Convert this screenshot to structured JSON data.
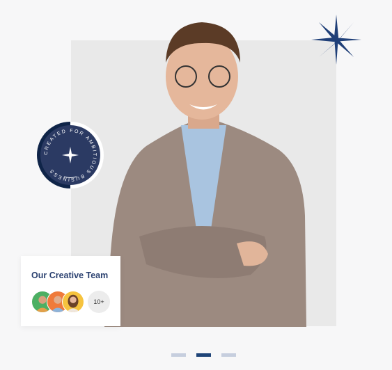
{
  "hero": {
    "badge_text": "CREATED FOR AMBITIOUS BUSINESS",
    "team_card": {
      "title": "Our Creative Team",
      "more_count": "10+"
    },
    "carousel": {
      "slides": 3,
      "active_index": 1
    },
    "colors": {
      "navy": "#2b3a63",
      "accent": "#1f4478"
    }
  }
}
